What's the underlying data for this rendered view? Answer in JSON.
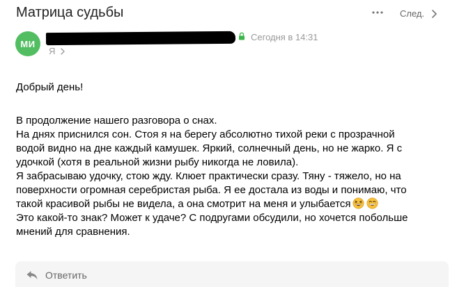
{
  "letter": {
    "subject": "Матрица судьбы",
    "next_label": "След.",
    "sender": {
      "initials": "МИ",
      "date": "Сегодня в 14:31"
    },
    "recipient": "Я",
    "greeting": "Добрый день!",
    "paragraph_lines": [
      "В продолжение нашего разговора о снах.",
      "На днях приснился сон. Стоя я на берегу абсолютно тихой реки с прозрачной",
      "водой видно на дне каждый камушек. Яркий, солнечный день, но не жарко. Я с",
      "удочкой (хотя в реальной жизни рыбу никогда не ловила).",
      "Я забрасываю удочку, стою жду. Клюет практически сразу. Тяну - тяжело, но на",
      "поверхности огромная серебристая рыба. Я ее достала из воды и понимаю, что",
      "такой красивой рыбы не видела, а она смотрит на меня и улыбается",
      "Это  какой-то знак? Может к удаче? С подругами обсудили, но хочется побольше",
      "мнений для сравнения."
    ],
    "reply_placeholder": "Ответить"
  },
  "colors": {
    "avatar_bg": "#52bd61",
    "secure_lock": "#3bb54a",
    "emoji_face": "#f7c13a",
    "reply_box_bg": "#f5f5f5",
    "muted_text": "#999999"
  },
  "icons": {
    "more": "more-horizontal-icon",
    "next": "chevron-right-icon",
    "secure": "lock-icon",
    "recipient_expand": "chevron-right-icon",
    "emoji_1": "laughing-face-emoji",
    "emoji_2": "grinning-face-emoji",
    "reply": "reply-arrow-icon"
  }
}
